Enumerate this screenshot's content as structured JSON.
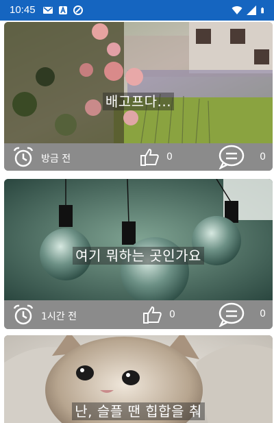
{
  "status_bar": {
    "time": "10:45",
    "left_icons": [
      "gmail-icon",
      "a-badge-icon",
      "data-saver-icon"
    ],
    "right_icons": [
      "wifi-icon",
      "signal-icon",
      "battery-icon"
    ],
    "color": "#1565c0"
  },
  "posts": [
    {
      "caption": "배고프다...",
      "time": "방금 전",
      "likes": "0",
      "comments": "0",
      "image": "flowers-garden"
    },
    {
      "caption": "여기 뭐하는 곳인가요",
      "time": "1시간 전",
      "likes": "0",
      "comments": "0",
      "image": "hanging-bulbs"
    },
    {
      "caption": "난, 슬플 땐 힙합을 춰",
      "image": "kitten"
    }
  ],
  "footer_icons": {
    "time": "alarm-clock-icon",
    "like": "thumbs-up-icon",
    "comment": "comment-bubble-icon"
  },
  "footer_color": "#8b8b8b"
}
